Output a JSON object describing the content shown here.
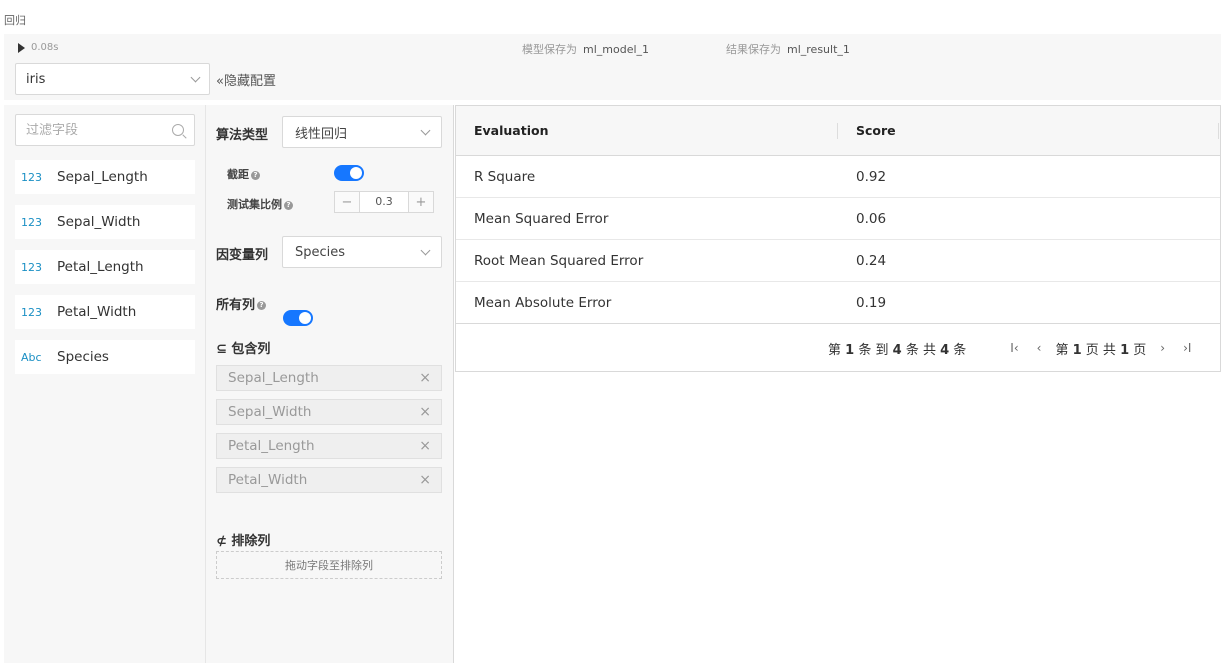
{
  "page": {
    "title": "回归"
  },
  "toolbar": {
    "run_time": "0.08s",
    "model_label": "模型保存为",
    "model_value": "ml_model_1",
    "result_label": "结果保存为",
    "result_value": "ml_result_1"
  },
  "dataset": {
    "selected": "iris"
  },
  "hide_config_label": "«隐藏配置",
  "fields": {
    "filter_placeholder": "过滤字段",
    "items": [
      {
        "type": "123",
        "name": "Sepal_Length"
      },
      {
        "type": "123",
        "name": "Sepal_Width"
      },
      {
        "type": "123",
        "name": "Petal_Length"
      },
      {
        "type": "123",
        "name": "Petal_Width"
      },
      {
        "type": "Abc",
        "name": "Species"
      }
    ]
  },
  "config": {
    "algo_label": "算法类型",
    "algo_value": "线性回归",
    "intercept_label": "截距",
    "intercept_on": true,
    "test_ratio_label": "测试集比例",
    "test_ratio_value": "0.3",
    "target_label": "因变量列",
    "target_value": "Species",
    "all_cols_label": "所有列",
    "all_cols_on": true,
    "include_label": "⊆ 包含列",
    "include_tags": [
      "Sepal_Length",
      "Sepal_Width",
      "Petal_Length",
      "Petal_Width"
    ],
    "exclude_label": "⊄ 排除列",
    "exclude_drop_hint": "拖动字段至排除列",
    "help_glyph": "?"
  },
  "results": {
    "columns": [
      "Evaluation",
      "Score"
    ],
    "rows": [
      {
        "evaluation": "R Square",
        "score": "0.92"
      },
      {
        "evaluation": "Mean Squared Error",
        "score": "0.06"
      },
      {
        "evaluation": "Root Mean Squared Error",
        "score": "0.24"
      },
      {
        "evaluation": "Mean Absolute Error",
        "score": "0.19"
      }
    ],
    "pager": {
      "range_prefix": "第",
      "range_from": "1",
      "range_mid": "条 到",
      "range_to": "4",
      "range_mid2": "条 共",
      "range_total": "4",
      "range_suffix": "条",
      "page_prefix": "第",
      "page_current": "1",
      "page_mid": "页 共",
      "page_total": "1",
      "page_suffix": "页",
      "first_icon": "I‹",
      "prev_icon": "‹",
      "next_icon": "›",
      "last_icon": "›I"
    }
  }
}
